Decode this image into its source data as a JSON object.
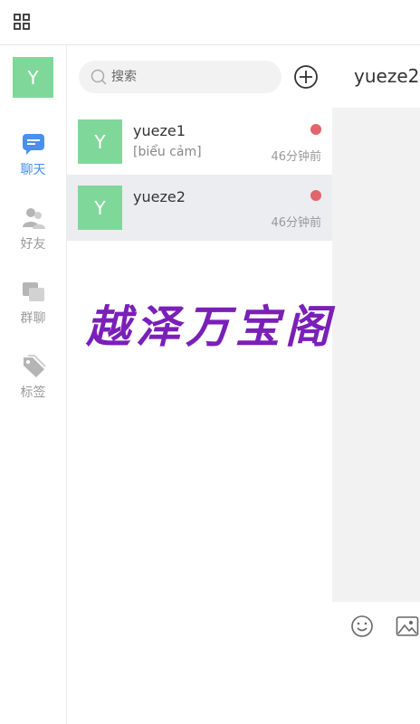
{
  "nav": {
    "avatar_letter": "Y",
    "items": [
      {
        "label": "聊天",
        "icon": "chat-icon",
        "active": true
      },
      {
        "label": "好友",
        "icon": "friends-icon",
        "active": false
      },
      {
        "label": "群聊",
        "icon": "group-chat-icon",
        "active": false
      },
      {
        "label": "标签",
        "icon": "tag-icon",
        "active": false
      }
    ]
  },
  "search": {
    "placeholder": "搜索"
  },
  "conversations": [
    {
      "avatar_letter": "Y",
      "name": "yueze1",
      "preview": "[biểu cảm]",
      "time": "46分钟前",
      "unread": true,
      "selected": false
    },
    {
      "avatar_letter": "Y",
      "name": "yueze2",
      "preview": "",
      "time": "46分钟前",
      "unread": true,
      "selected": true
    }
  ],
  "watermark": "越泽万宝阁",
  "chat": {
    "title": "yueze2"
  },
  "colors": {
    "accent": "#3d8ef2",
    "avatar": "#7fd89a",
    "unread_dot": "#e0666b",
    "watermark": "#7a1fb8",
    "selected_row": "#ebedf1"
  }
}
